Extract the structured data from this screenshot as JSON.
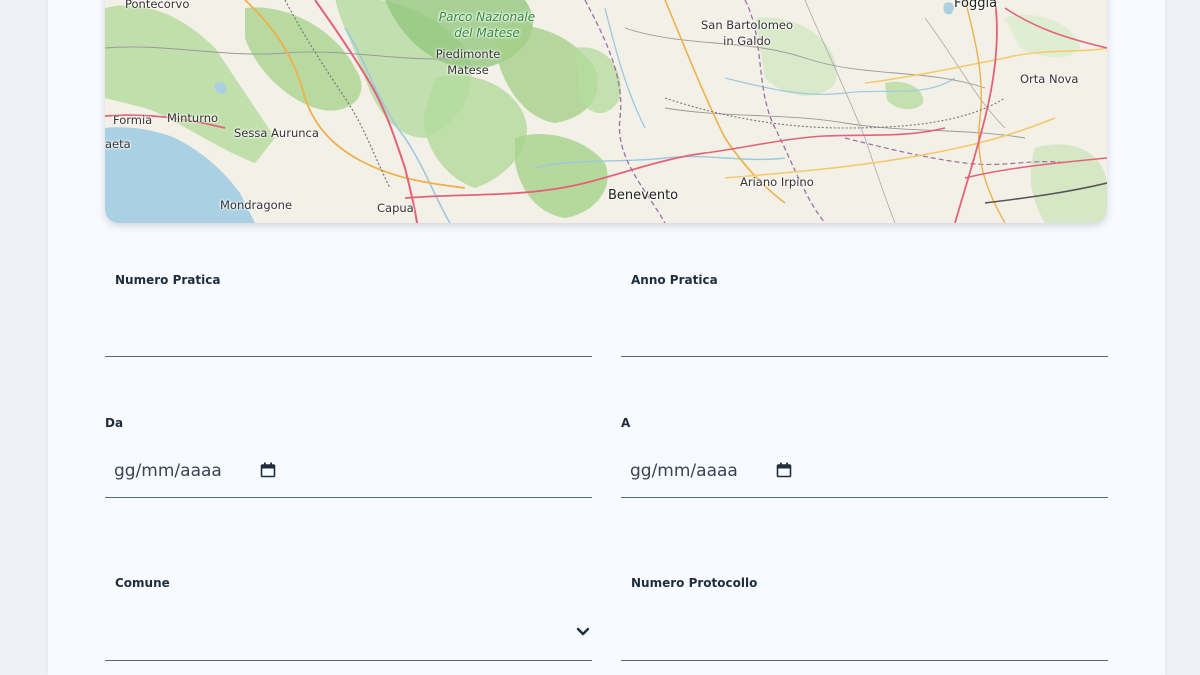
{
  "map": {
    "labels": {
      "pontecorvo": "Pontecorvo",
      "parco1": "Parco Nazionale",
      "parco2": "del Matese",
      "piedimonte1": "Piedimonte",
      "piedimonte2": "Matese",
      "sanbart1": "San Bartolomeo",
      "sanbart2": "in Galdo",
      "foggia": "Foggia",
      "ortanova": "Orta Nova",
      "formia": "Formia",
      "minturno": "Minturno",
      "sessa": "Sessa Aurunca",
      "gaeta": "aeta",
      "mondragone": "Mondragone",
      "capua": "Capua",
      "benevento": "Benevento",
      "ariano": "Ariano Irpino"
    }
  },
  "form": {
    "numero_pratica": {
      "label": "Numero Pratica",
      "value": ""
    },
    "anno_pratica": {
      "label": "Anno Pratica",
      "value": ""
    },
    "da": {
      "label": "Da",
      "placeholder": "gg/mm/aaaa"
    },
    "a": {
      "label": "A",
      "placeholder": "gg/mm/aaaa"
    },
    "comune": {
      "label": "Comune",
      "value": ""
    },
    "numero_protocollo": {
      "label": "Numero Protocollo",
      "value": ""
    }
  },
  "colors": {
    "sea": "#a9d0e3",
    "forest": "#a9d48e",
    "road_red": "#e3627a",
    "road_orange": "#f0b04a"
  },
  "icons": [
    "calendar-icon",
    "chevron-down-icon"
  ]
}
